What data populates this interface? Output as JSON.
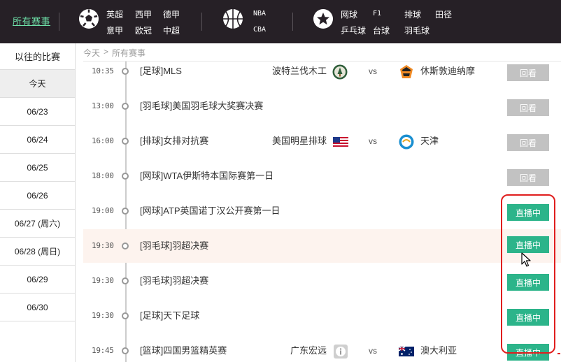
{
  "nav": {
    "all_events": "所有赛事",
    "soccer": [
      "英超",
      "西甲",
      "德甲",
      "意甲",
      "欧冠",
      "中超"
    ],
    "basketball": [
      "NBA",
      "CBA"
    ],
    "other": [
      "网球",
      "F1",
      "排球",
      "田径",
      "乒乓球",
      "台球",
      "羽毛球"
    ]
  },
  "sidebar": {
    "history": "以往的比赛",
    "days": [
      "今天",
      "06/23",
      "06/24",
      "06/25",
      "06/26",
      "06/27 (周六)",
      "06/28 (周日)",
      "06/29",
      "06/30"
    ],
    "active_index": 0
  },
  "breadcrumb": {
    "today": "今天",
    "separator": ">",
    "current": "所有赛事"
  },
  "status_labels": {
    "replay": "回看",
    "live": "直播中"
  },
  "vs_label": "vs",
  "colors": {
    "accent_green": "#2cb48a",
    "nav_bg": "#262026",
    "highlight_red": "#e01e1e"
  },
  "matches": [
    {
      "time": "10:35",
      "title": "[足球]MLS",
      "home": "波特兰伐木工",
      "away": "休斯敦迪纳摩",
      "home_logo": "portland-timbers-logo",
      "away_logo": "houston-dynamo-logo",
      "status": "回看"
    },
    {
      "time": "13:00",
      "title": "[羽毛球]美国羽毛球大奖赛决赛",
      "status": "回看"
    },
    {
      "time": "16:00",
      "title": "[排球]女排对抗赛",
      "home": "美国明星排球",
      "away": "天津",
      "home_logo": "usa-flag-icon",
      "away_logo": "tianjin-logo",
      "status": "回看"
    },
    {
      "time": "18:00",
      "title": "[网球]WTA伊斯特本国际赛第一日",
      "status": "回看"
    },
    {
      "time": "19:00",
      "title": "[网球]ATP英国诺丁汉公开赛第一日",
      "status": "直播中"
    },
    {
      "time": "19:30",
      "title": "[羽毛球]羽超决赛",
      "status": "直播中"
    },
    {
      "time": "19:30",
      "title": "[羽毛球]羽超决赛",
      "status": "直播中"
    },
    {
      "time": "19:30",
      "title": "[足球]天下足球",
      "status": "直播中"
    },
    {
      "time": "19:45",
      "title": "[篮球]四国男篮精英赛",
      "home": "广东宏远",
      "away": "澳大利亚",
      "home_logo": "info-icon",
      "away_logo": "australia-flag-icon",
      "status": "直播中"
    }
  ]
}
